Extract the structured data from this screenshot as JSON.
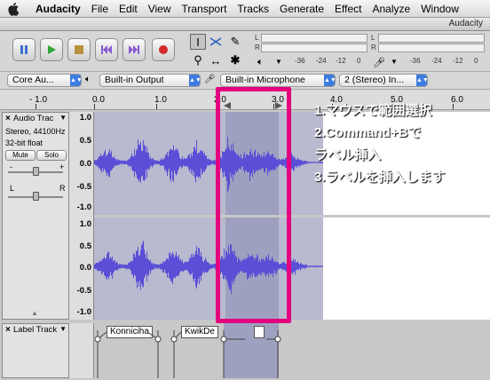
{
  "menubar": {
    "app": "Audacity",
    "items": [
      "File",
      "Edit",
      "View",
      "Transport",
      "Tracks",
      "Generate",
      "Effect",
      "Analyze",
      "Window"
    ]
  },
  "window": {
    "title": "Audacity"
  },
  "meters": {
    "play": {
      "label_l": "L",
      "label_r": "R",
      "ticks": [
        "-36",
        "-24",
        "-12",
        "0"
      ]
    },
    "record": {
      "label_l": "L",
      "label_r": "R",
      "ticks": [
        "-36",
        "-24",
        "-12",
        "0"
      ]
    }
  },
  "devices": {
    "host": "Core Au...",
    "output": "Built-in Output",
    "input": "Built-in Microphone",
    "channels": "2 (Stereo) In..."
  },
  "ruler": {
    "ticks": [
      "- 1.0",
      "0.0",
      "1.0",
      "2.0",
      "3.0",
      "4.0",
      "5.0",
      "6.0"
    ]
  },
  "audio_track": {
    "name": "Audio Trac",
    "rate": "Stereo, 44100Hz",
    "format": "32-bit float",
    "mute": "Mute",
    "solo": "Solo",
    "gain_minus": "-",
    "gain_plus": "+",
    "pan_l": "L",
    "pan_r": "R",
    "scale": [
      "1.0",
      "0.5",
      "0.0",
      "-0.5",
      "-1.0"
    ]
  },
  "label_track": {
    "name": "Label Track",
    "labels": [
      "Konniciha",
      "KwikDe",
      ""
    ]
  },
  "annotation": {
    "lines": [
      "1.マウスで範囲選択",
      "2.Command+Bで",
      "ラベル挿入",
      "3.ラベルを挿入します"
    ]
  },
  "colors": {
    "wave": "#5a4fd6",
    "selection": "#9ea0bf",
    "highlight": "#e4007f"
  }
}
